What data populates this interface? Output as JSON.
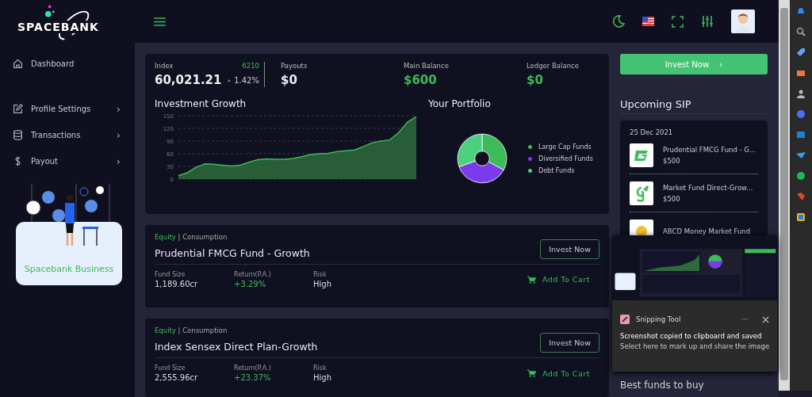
{
  "brand": {
    "name": "SPACEBANK"
  },
  "sidebar": {
    "items": [
      {
        "label": "Dashboard"
      },
      {
        "label": "Profile Settings",
        "chevron": "›"
      },
      {
        "label": "Transactions",
        "chevron": "›"
      },
      {
        "label": "Payout",
        "chevron": "›"
      }
    ],
    "promo": {
      "label": "Spacebank Business"
    }
  },
  "stats": {
    "index": {
      "label": "Index",
      "badge": "6210",
      "value": "60,021.21",
      "change": "1.42%"
    },
    "items": [
      {
        "label": "Payouts",
        "value": "$0",
        "highlight": false
      },
      {
        "label": "Main Balance",
        "value": "$600",
        "highlight": true
      },
      {
        "label": "Ledger Balance",
        "value": "$0",
        "highlight": true
      }
    ]
  },
  "growth": {
    "title": "Investment Growth",
    "chart_data": {
      "type": "area",
      "ylim": [
        0,
        150
      ],
      "yticks": [
        0,
        30,
        60,
        90,
        120,
        150
      ],
      "grid": true,
      "values": [
        8,
        15,
        28,
        36,
        35,
        33,
        31,
        33,
        40,
        46,
        48,
        47,
        47,
        49,
        53,
        58,
        60,
        61,
        65,
        67,
        69,
        77,
        86,
        90,
        93,
        110,
        135,
        148
      ]
    }
  },
  "portfolio": {
    "title": "Your Portfolio",
    "legend": [
      {
        "label": "Large Cap Funds",
        "color": "#3dba5a"
      },
      {
        "label": "Diversified Funds",
        "color": "#7c3aed"
      },
      {
        "label": "Debt Funds",
        "color": "#4cd07d"
      }
    ]
  },
  "invest_button": {
    "label": "Invest Now",
    "arrow": "›"
  },
  "sip": {
    "title": "Upcoming SIP",
    "date": "25 Dec 2021",
    "items": [
      {
        "name": "Prudential FMCG Fund - G...",
        "amount": "$500"
      },
      {
        "name": "Market Fund Direct-Grow...",
        "amount": "$500"
      },
      {
        "name": "ABCD Money Market Fund"
      }
    ],
    "next_title": "Best funds to buy"
  },
  "funds": [
    {
      "category": "Equity",
      "separator": "|",
      "subcategory": "Consumption",
      "name": "Prudential FMCG Fund - Growth",
      "button": "Invest Now",
      "cart": "Add To Cart",
      "metrics": [
        {
          "label": "Fund Size",
          "value": "1,189.60cr",
          "positive": false
        },
        {
          "label": "Return(P.A.)",
          "value": "+3.29%",
          "positive": true
        },
        {
          "label": "Risk",
          "value": "High",
          "positive": false
        }
      ]
    },
    {
      "category": "Equity",
      "separator": "|",
      "subcategory": "Consumption",
      "name": "Index Sensex Direct Plan-Growth",
      "button": "Invest Now",
      "cart": "Add To Cart",
      "metrics": [
        {
          "label": "Fund Size",
          "value": "2,555.96cr",
          "positive": false
        },
        {
          "label": "Return(P.A.)",
          "value": "+23.37%",
          "positive": true
        },
        {
          "label": "Risk",
          "value": "High",
          "positive": false
        }
      ]
    }
  ],
  "notification": {
    "app": "Snipping Tool",
    "menu": "···",
    "title": "Screenshot copied to clipboard and saved",
    "body": "Select here to mark up and share the image"
  }
}
